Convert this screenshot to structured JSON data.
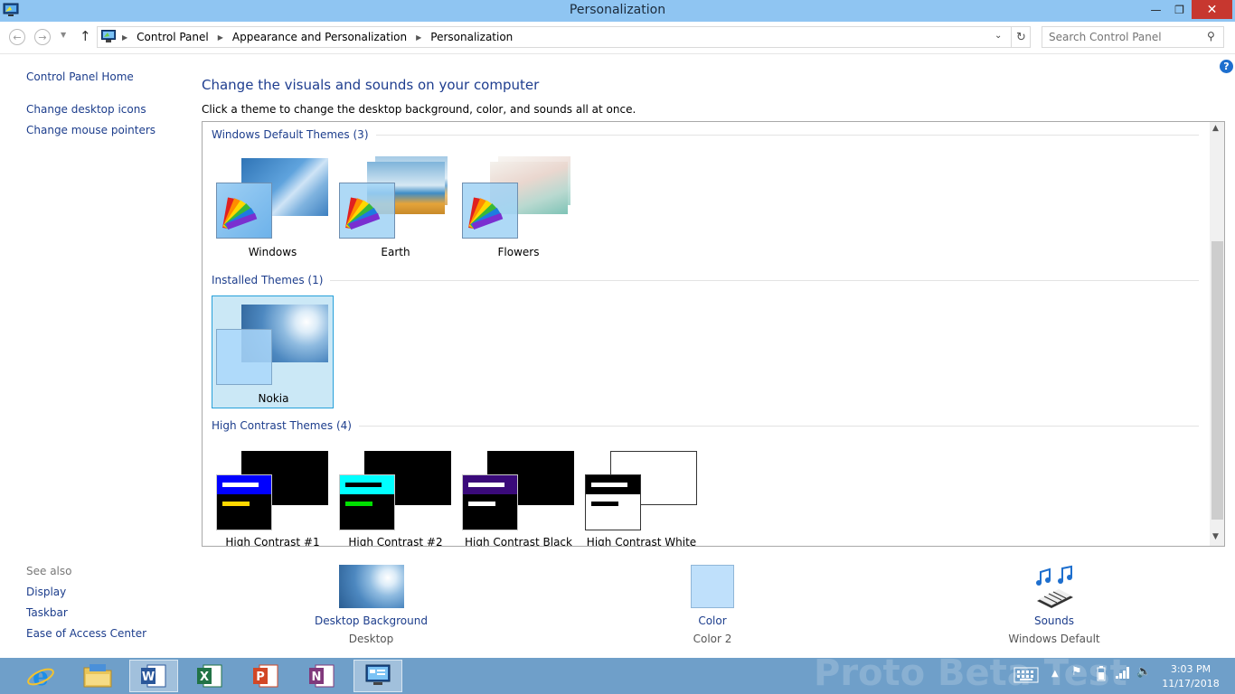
{
  "window": {
    "title": "Personalization",
    "minimize_glyph": "—",
    "maximize_glyph": "❐",
    "close_glyph": "✕"
  },
  "address": {
    "crumbs": [
      "Control Panel",
      "Appearance and Personalization",
      "Personalization"
    ],
    "search_placeholder": "Search Control Panel"
  },
  "sidebar": {
    "links": [
      "Control Panel Home",
      "Change desktop icons",
      "Change mouse pointers"
    ],
    "see_also_title": "See also",
    "see_also": [
      "Display",
      "Taskbar",
      "Ease of Access Center"
    ]
  },
  "main": {
    "heading": "Change the visuals and sounds on your computer",
    "subtext": "Click a theme to change the desktop background, color, and sounds all at once."
  },
  "groups": {
    "default_title": "Windows Default Themes (3)",
    "installed_title": "Installed Themes (1)",
    "high_contrast_title": "High Contrast Themes (4)"
  },
  "themes": {
    "default": [
      "Windows",
      "Earth",
      "Flowers"
    ],
    "installed": [
      "Nokia"
    ],
    "high_contrast": [
      "High Contrast #1",
      "High Contrast #2",
      "High Contrast Black",
      "High Contrast White"
    ]
  },
  "bottom": {
    "background": {
      "title": "Desktop Background",
      "sub": "Desktop"
    },
    "color": {
      "title": "Color",
      "sub": "Color 2"
    },
    "sounds": {
      "title": "Sounds",
      "sub": "Windows Default"
    }
  },
  "taskbar": {
    "watermark": "Proto Beta Test",
    "time": "3:03 PM",
    "date": "11/17/2018"
  },
  "colors": {
    "title_bar": "#8fc5f2",
    "link": "#1c3d8c",
    "heading": "#1e3d8f",
    "selection": "#cbe8f6",
    "taskbar": "#6f9fc9",
    "close_button": "#c7372f"
  }
}
